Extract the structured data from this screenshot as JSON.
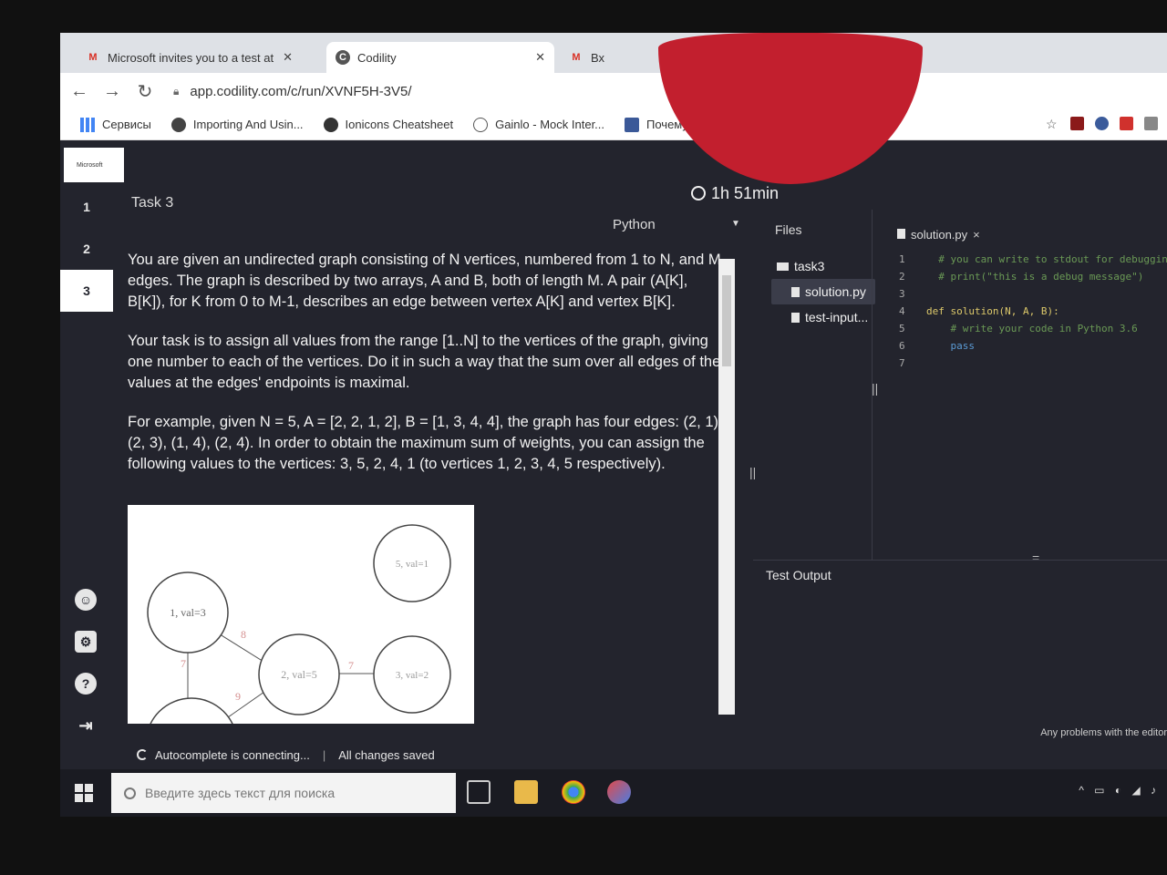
{
  "browser": {
    "tabs": [
      {
        "label": "Microsoft invites you to a test at",
        "icon": "gmail-icon"
      },
      {
        "label": "Codility",
        "icon": "codility-icon"
      },
      {
        "label": "Вх",
        "icon": "gmail-icon"
      }
    ],
    "url": "app.codility.com/c/run/XVNF5H-3V5/",
    "bookmarks": [
      {
        "label": "Сервисы"
      },
      {
        "label": "Importing And Usin..."
      },
      {
        "label": "Ionicons Cheatsheet"
      },
      {
        "label": "Gainlo - Mock Inter..."
      },
      {
        "label": "Почему тормозит..."
      }
    ]
  },
  "app": {
    "logo_text": "Microsoft",
    "task_numbers": [
      "1",
      "2",
      "3"
    ],
    "current_task": "3",
    "task_title": "Task 3",
    "timer": "1h 51min",
    "language": "Python",
    "description": [
      "You are given an undirected graph consisting of N vertices, numbered from 1 to N, and M edges. The graph is described by two arrays, A and B, both of length M. A pair (A[K], B[K]), for K from 0 to M-1, describes an edge between vertex A[K] and vertex B[K].",
      "Your task is to assign all values from the range [1..N] to the vertices of the graph, giving one number to each of the vertices. Do it in such a way that the sum over all edges of the values at the edges' endpoints is maximal.",
      "For example, given N = 5, A = [2, 2, 1, 2], B = [1, 3, 4, 4], the graph has four edges: (2, 1), (2, 3), (1, 4), (2, 4). In order to obtain the maximum sum of weights, you can assign the following values to the vertices: 3, 5, 2, 4, 1 (to vertices 1, 2, 3, 4, 5 respectively)."
    ],
    "figure": {
      "nodes": [
        "5, val=1",
        "1, val=3",
        "2, val=5",
        "3, val=2"
      ],
      "edge_labels": [
        "8",
        "7",
        "7",
        "9"
      ]
    },
    "files_heading": "Files",
    "folder": "task3",
    "files": [
      "solution.py",
      "test-input..."
    ],
    "editor_tab": "solution.py",
    "code_lines": [
      {
        "n": "1",
        "text": "  # you can write to stdout for debugging",
        "cls": "c-comment"
      },
      {
        "n": "2",
        "text": "  # print(\"this is a debug message\")",
        "cls": "c-comment"
      },
      {
        "n": "3",
        "text": "",
        "cls": ""
      },
      {
        "n": "4",
        "text": "def solution(N, A, B):",
        "cls": "c-fn"
      },
      {
        "n": "5",
        "text": "    # write your code in Python 3.6",
        "cls": "c-comment"
      },
      {
        "n": "6",
        "text": "    pass",
        "cls": "c-kw"
      },
      {
        "n": "7",
        "text": "",
        "cls": ""
      }
    ],
    "test_output_label": "Test Output",
    "problems_text": "Any problems with the editor",
    "status_autocomplete": "Autocomplete is connecting...",
    "status_saved": "All changes saved"
  },
  "taskbar": {
    "search_placeholder": "Введите здесь текст для поиска"
  }
}
